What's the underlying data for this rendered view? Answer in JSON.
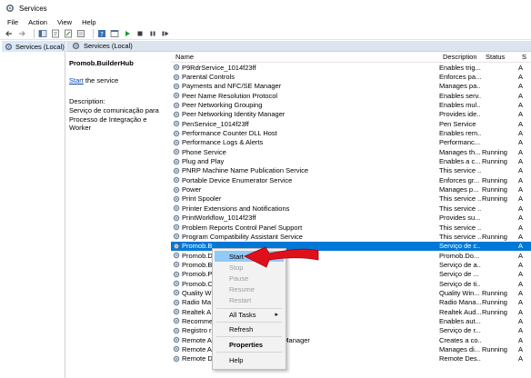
{
  "window": {
    "title": "Services"
  },
  "menu": [
    "File",
    "Action",
    "View",
    "Help"
  ],
  "tree": {
    "item": "Services (Local)"
  },
  "pane_header": "Services (Local)",
  "detail": {
    "service_name": "Promob.BuilderHub",
    "action_link": "Start",
    "action_suffix": " the service",
    "description_label": "Description:",
    "description_text": "Serviço de comunicação para Processo de Integração e Worker"
  },
  "columns": {
    "name": "Name",
    "description": "Description",
    "status": "Status",
    "startup": "S"
  },
  "rows": [
    {
      "name": "P9RdrService_1014f23ff",
      "description": "Enables trig...",
      "status": "",
      "startup": "A"
    },
    {
      "name": "Parental Controls",
      "description": "Enforces pa...",
      "status": "",
      "startup": "A"
    },
    {
      "name": "Payments and NFC/SE Manager",
      "description": "Manages pa...",
      "status": "",
      "startup": "A"
    },
    {
      "name": "Peer Name Resolution Protocol",
      "description": "Enables serv...",
      "status": "",
      "startup": "A"
    },
    {
      "name": "Peer Networking Grouping",
      "description": "Enables mul...",
      "status": "",
      "startup": "A"
    },
    {
      "name": "Peer Networking Identity Manager",
      "description": "Provides ide...",
      "status": "",
      "startup": "A"
    },
    {
      "name": "PenService_1014f23ff",
      "description": "Pen Service",
      "status": "",
      "startup": "A"
    },
    {
      "name": "Performance Counter DLL Host",
      "description": "Enables rem...",
      "status": "",
      "startup": "A"
    },
    {
      "name": "Performance Logs & Alerts",
      "description": "Performanc...",
      "status": "",
      "startup": "A"
    },
    {
      "name": "Phone Service",
      "description": "Manages th...",
      "status": "Running",
      "startup": "A"
    },
    {
      "name": "Plug and Play",
      "description": "Enables a c...",
      "status": "Running",
      "startup": "A"
    },
    {
      "name": "PNRP Machine Name Publication Service",
      "description": "This service ...",
      "status": "",
      "startup": "A"
    },
    {
      "name": "Portable Device Enumerator Service",
      "description": "Enforces gr...",
      "status": "Running",
      "startup": "A"
    },
    {
      "name": "Power",
      "description": "Manages p...",
      "status": "Running",
      "startup": "A"
    },
    {
      "name": "Print Spooler",
      "description": "This service ...",
      "status": "Running",
      "startup": "A"
    },
    {
      "name": "Printer Extensions and Notifications",
      "description": "This service ...",
      "status": "",
      "startup": "A"
    },
    {
      "name": "PrintWorkflow_1014f23ff",
      "description": "Provides su...",
      "status": "",
      "startup": "A"
    },
    {
      "name": "Problem Reports Control Panel Support",
      "description": "This service ...",
      "status": "",
      "startup": "A"
    },
    {
      "name": "Program Compatibility Assistant Service",
      "description": "This service ...",
      "status": "Running",
      "startup": "A"
    },
    {
      "name": "Promob.B",
      "description": "Serviço de c...",
      "status": "",
      "startup": "A",
      "selected": true
    },
    {
      "name": "Promob.D",
      "description": "Promob.Do...",
      "status": "",
      "startup": "A"
    },
    {
      "name": "Promob.B",
      "description": "Serviço de a...",
      "status": "",
      "startup": "A"
    },
    {
      "name": "Promob.P",
      "description": "Serviço de ...",
      "status": "",
      "startup": "A"
    },
    {
      "name": "Promob.C",
      "description": "Serviço de ti...",
      "status": "",
      "startup": "A"
    },
    {
      "name": "Quality W",
      "description": "Quality Win...",
      "status": "Running",
      "startup": "A"
    },
    {
      "name": "Radio Ma",
      "description": "Radio Mana...",
      "status": "Running",
      "startup": "A"
    },
    {
      "name": "Realtek A",
      "description": "Realtek Aud...",
      "status": "Running",
      "startup": "A"
    },
    {
      "name": "Recomme",
      "description": "Enables aut...",
      "status": "",
      "startup": "A"
    },
    {
      "name": "Registro r",
      "description": "Serviço de r...",
      "status": "",
      "startup": "A"
    },
    {
      "name": "Remote Access Auto Connection Manager",
      "description": "Creates a co...",
      "status": "",
      "startup": "A"
    },
    {
      "name": "Remote A",
      "description": "Manages di...",
      "status": "Running",
      "startup": "A"
    },
    {
      "name": "Remote Desktop Configuration",
      "description": "Remote Des...",
      "status": "",
      "startup": "A"
    }
  ],
  "context_menu": {
    "start": "Start",
    "stop": "Stop",
    "pause": "Pause",
    "resume": "Resume",
    "restart": "Restart",
    "all_tasks": "All Tasks",
    "refresh": "Refresh",
    "properties": "Properties",
    "help": "Help"
  },
  "colors": {
    "selection": "#0078d7",
    "menu_highlight": "#91c9f7",
    "annotation_arrow": "#e0101a"
  }
}
